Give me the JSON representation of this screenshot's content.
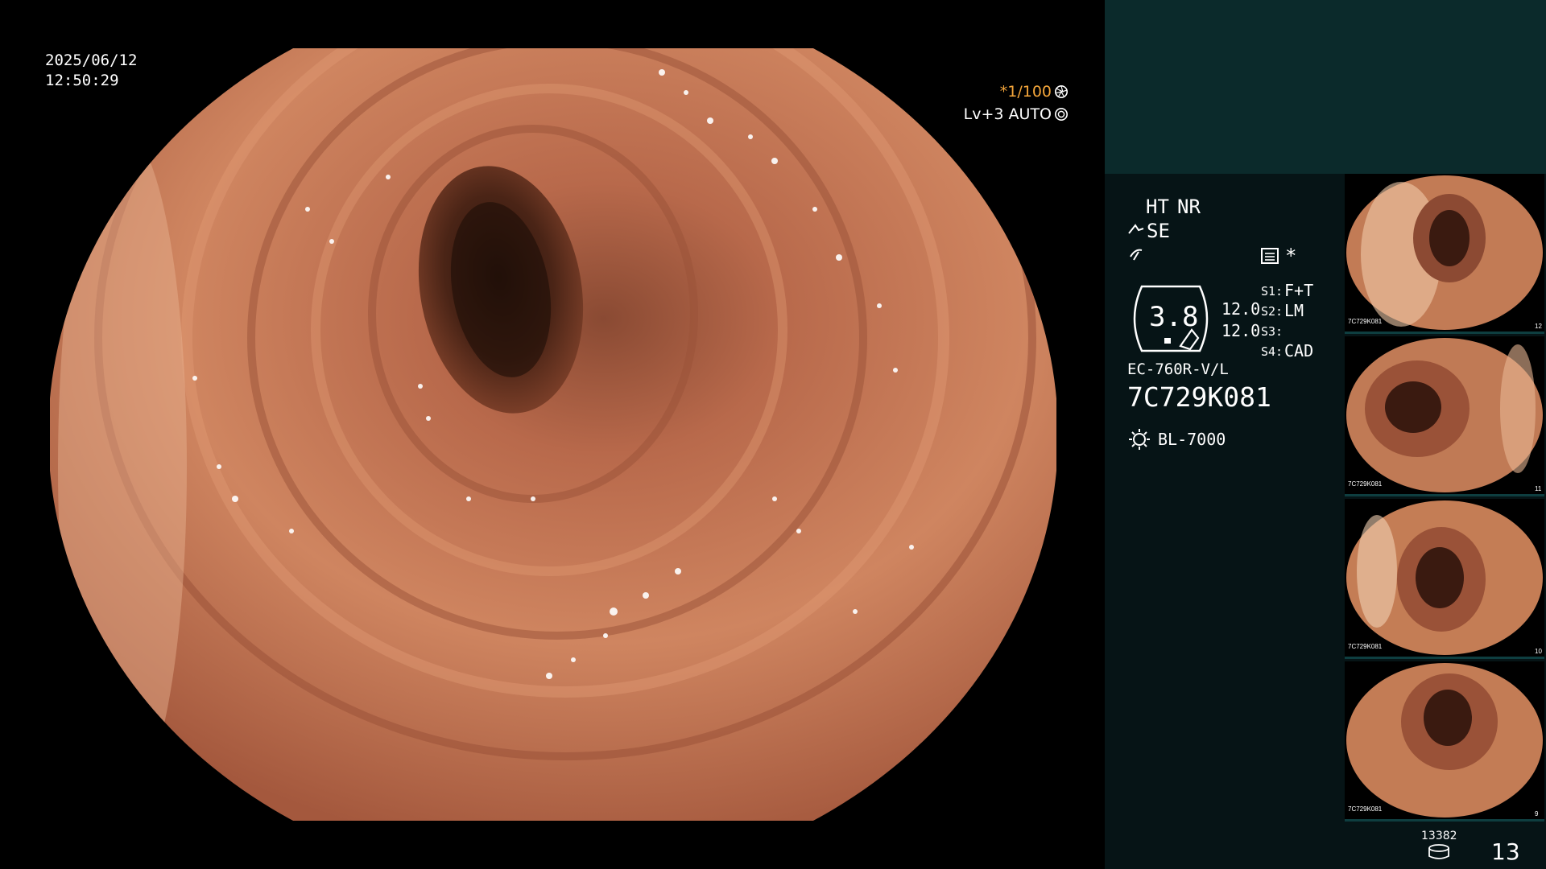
{
  "overlay": {
    "date": "2025/06/12",
    "time": "12:50:29",
    "shutter": "*1/100",
    "level": "Lv+3 AUTO"
  },
  "panel": {
    "ht": "HT",
    "nr": "NR",
    "se": "SE",
    "asterisk": "*",
    "gauge_value": "3.8",
    "side_value_1": "12.0",
    "side_value_2": "12.0",
    "s1_label": "S1:",
    "s1_value": "F+T",
    "s2_label": "S2:",
    "s2_value": "LM",
    "s3_label": "S3:",
    "s3_value": "",
    "s4_label": "S4:",
    "s4_value": "CAD",
    "scope_model": "EC-760R-V/L",
    "serial": "7C729K081",
    "light_source": "BL-7000",
    "image_count": "13382",
    "frame_number": "13"
  },
  "thumbnails": [
    {
      "label": "7C729K081",
      "num": "12"
    },
    {
      "label": "7C729K081",
      "num": "11"
    },
    {
      "label": "7C729K081",
      "num": "10"
    },
    {
      "label": "7C729K081",
      "num": "9"
    }
  ],
  "colors": {
    "accent_orange": "#f3a53a",
    "panel_bg": "#061416",
    "panel_top": "#0b2a2b",
    "tissue": "#c0744f"
  },
  "icons": [
    "aperture-icon",
    "iris-icon",
    "scope-icon",
    "lightning-icon",
    "settings-icon",
    "light-source-icon",
    "storage-icon"
  ]
}
